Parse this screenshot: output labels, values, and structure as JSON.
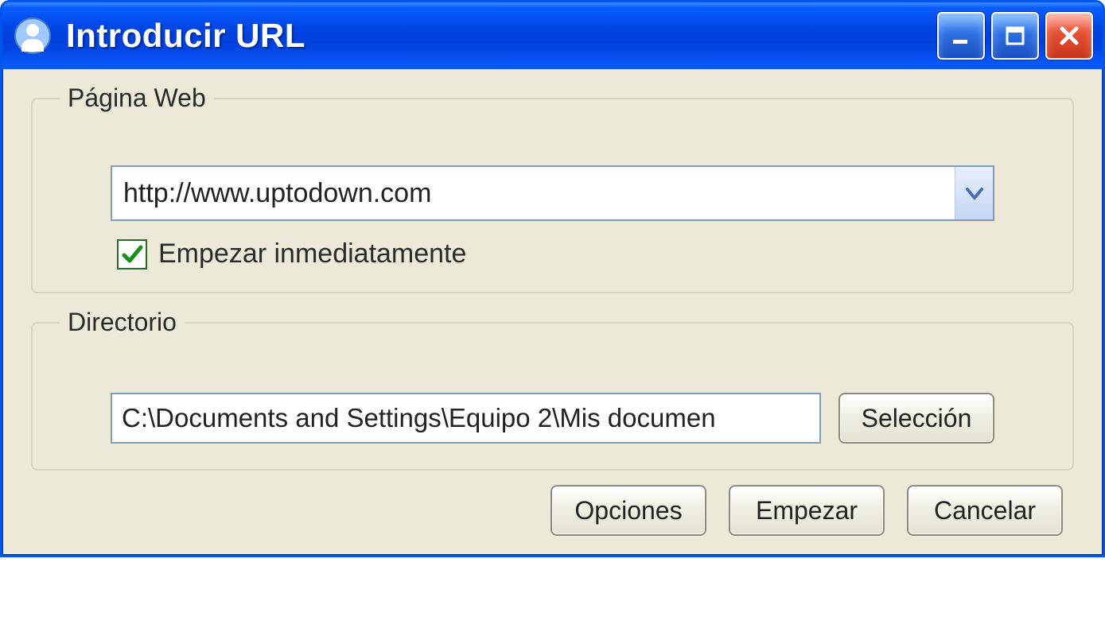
{
  "window": {
    "title": "Introducir URL"
  },
  "groups": {
    "web": {
      "legend": "Página Web",
      "url_value": "http://www.uptodown.com",
      "start_immediately_label": "Empezar inmediatamente",
      "start_immediately_checked": true
    },
    "directory": {
      "legend": "Directorio",
      "path_value": "C:\\Documents and Settings\\Equipo 2\\Mis documen",
      "select_button": "Selección"
    }
  },
  "buttons": {
    "options": "Opciones",
    "start": "Empezar",
    "cancel": "Cancelar"
  }
}
